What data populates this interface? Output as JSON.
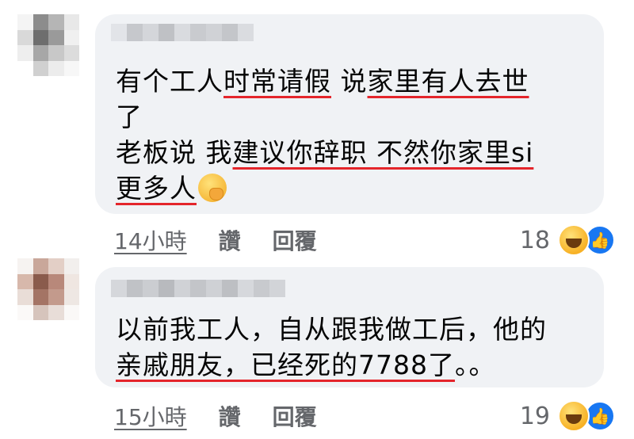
{
  "comments": [
    {
      "lines": [
        [
          {
            "t": "有个工人"
          },
          {
            "t": "时常请假",
            "u": true
          },
          {
            "t": " 说"
          },
          {
            "t": "家里有人去世",
            "u": true
          }
        ],
        [
          {
            "t": "了"
          }
        ],
        [
          {
            "t": "老板说 我"
          },
          {
            "t": "建议你辞职 不然你家里si",
            "u": true
          }
        ],
        [
          {
            "t": "更多人",
            "u": true
          },
          {
            "emoji": "hand-over-mouth-emoji"
          }
        ]
      ],
      "time": "14小時",
      "like_label": "讚",
      "reply_label": "回覆",
      "reaction_count": "18",
      "reaction_icons": [
        "haha-icon",
        "like-icon"
      ]
    },
    {
      "lines": [
        [
          {
            "t": "以前我工人，自从跟我做工后，他的"
          }
        ],
        [
          {
            "t": "亲戚朋友，已经死的7788了",
            "u": true
          },
          {
            "t": "。。"
          }
        ]
      ],
      "time": "15小時",
      "like_label": "讚",
      "reply_label": "回覆",
      "reaction_count": "19",
      "reaction_icons": [
        "haha-icon",
        "like-icon"
      ]
    }
  ],
  "colors": {
    "bubble": "#f0f2f5",
    "text": "#050505",
    "meta": "#65676b",
    "annotation_underline": "#e4252b",
    "like_blue": "#1877f2"
  }
}
